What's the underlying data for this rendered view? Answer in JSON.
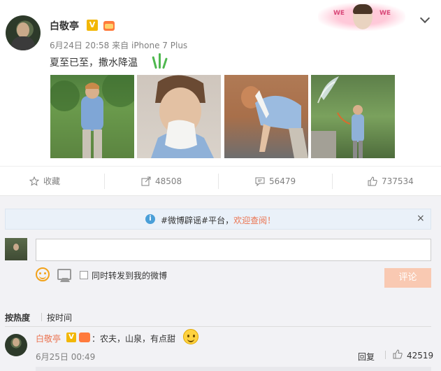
{
  "post": {
    "author": "白敬亭",
    "verified_badge": "V",
    "time": "6月24日 20:58",
    "source_prefix": "来自",
    "source": "iPhone 7 Plus",
    "text": "夏至已至，撒水降温",
    "promo_tags": [
      "WE",
      "WE"
    ],
    "photos": [
      "photo-1",
      "photo-2",
      "photo-3",
      "photo-4"
    ]
  },
  "actions": {
    "favorite": {
      "label": "收藏",
      "icon": "star-icon"
    },
    "repost": {
      "count": "48508",
      "icon": "share-icon"
    },
    "comment": {
      "count": "56479",
      "icon": "comment-icon"
    },
    "like": {
      "count": "737534",
      "icon": "thumb-up-icon"
    }
  },
  "comments": {
    "notice": {
      "prefix": "#微博辟谣#平台，",
      "link": "欢迎查阅！",
      "info_icon": "i",
      "close": "×"
    },
    "input": {
      "value": "",
      "placeholder": ""
    },
    "repost_option": "同时转发到我的微博",
    "submit_label": "评论",
    "sort": {
      "hot": "按热度",
      "time": "按时间"
    },
    "items": [
      {
        "author": "白敬亭",
        "verified_badge": "V",
        "text": "：农夫，山泉，有点甜",
        "time": "6月25日 00:49",
        "reply_label": "回复",
        "likes": "42519"
      }
    ]
  },
  "colors": {
    "accent": "#eb7350",
    "verified": "#f2b705",
    "submit_disabled": "#f9c9b2",
    "panel_bg": "#f2f2f5"
  }
}
